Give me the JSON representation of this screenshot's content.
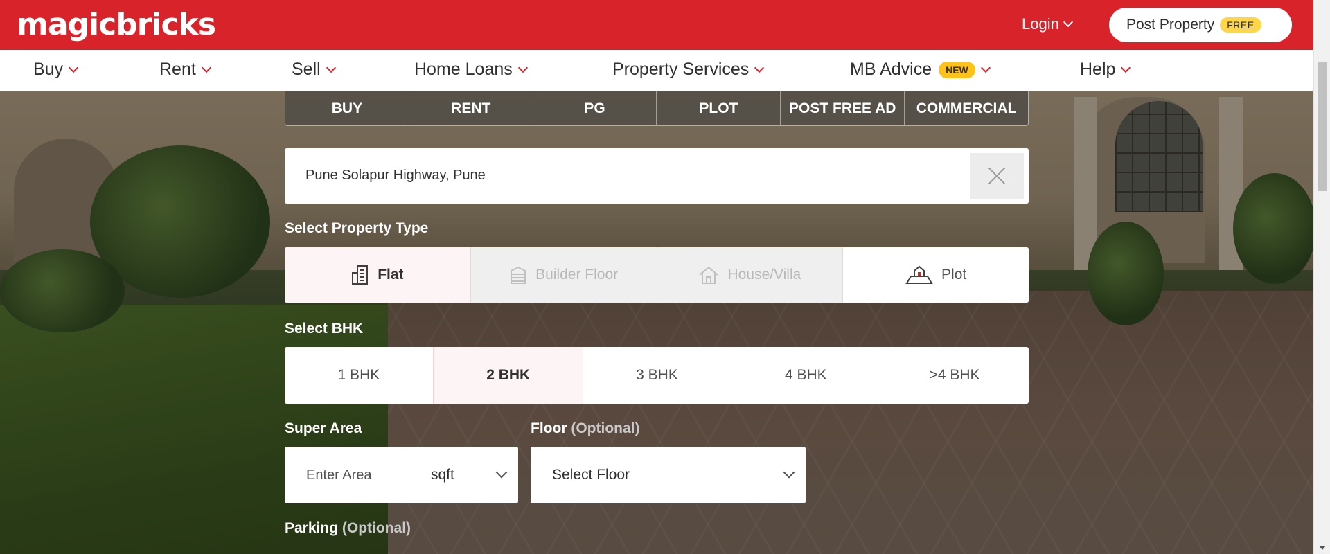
{
  "brand": {
    "name": "magicbricks",
    "color": "#d8232a"
  },
  "header": {
    "login_label": "Login",
    "post_property_label": "Post Property",
    "free_badge": "FREE"
  },
  "nav": {
    "items": [
      {
        "label": "Buy"
      },
      {
        "label": "Rent"
      },
      {
        "label": "Sell"
      },
      {
        "label": "Home Loans"
      },
      {
        "label": "Property Services"
      },
      {
        "label": "MB Advice",
        "badge": "NEW"
      },
      {
        "label": "Help"
      }
    ]
  },
  "tabs": [
    "BUY",
    "RENT",
    "PG",
    "PLOT",
    "POST FREE AD",
    "COMMERCIAL"
  ],
  "search": {
    "value": "Pune Solapur Highway, Pune",
    "clear_icon": "close-icon"
  },
  "property_type": {
    "label": "Select Property Type",
    "options": [
      {
        "label": "Flat",
        "icon": "building-icon",
        "state": "selected"
      },
      {
        "label": "Builder Floor",
        "icon": "floors-icon",
        "state": "disabled"
      },
      {
        "label": "House/Villa",
        "icon": "house-icon",
        "state": "disabled"
      },
      {
        "label": "Plot",
        "icon": "plot-icon",
        "state": "normal"
      }
    ]
  },
  "bhk": {
    "label": "Select BHK",
    "options": [
      "1 BHK",
      "2 BHK",
      "3 BHK",
      "4 BHK",
      ">4 BHK"
    ],
    "selected": "2 BHK"
  },
  "super_area": {
    "label": "Super Area",
    "placeholder": "Enter Area",
    "unit": "sqft"
  },
  "floor": {
    "label": "Floor",
    "optional": "(Optional)",
    "value": "Select Floor"
  },
  "parking": {
    "label": "Parking",
    "optional": "(Optional)"
  }
}
